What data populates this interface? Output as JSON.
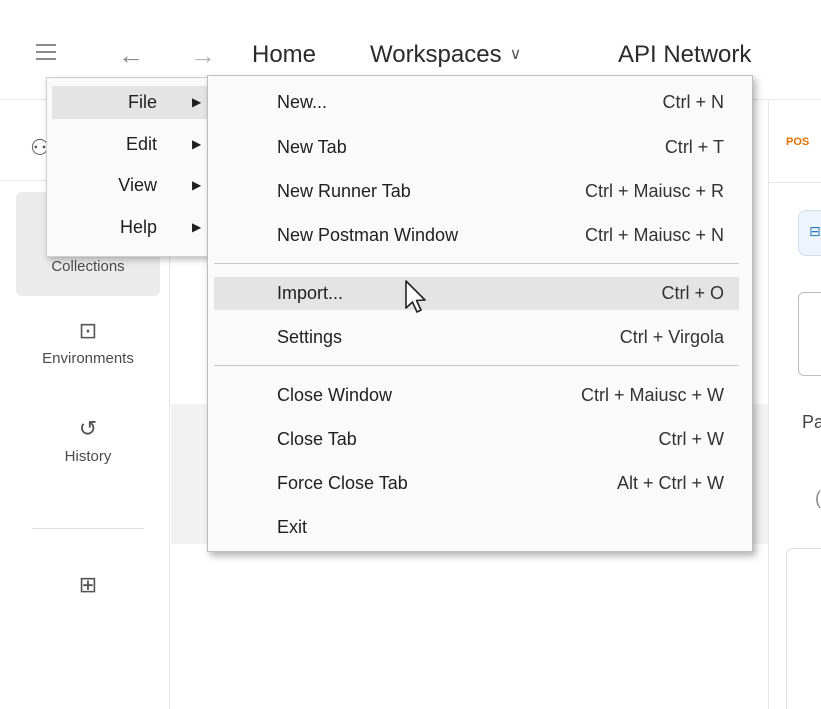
{
  "topbar": {
    "home": "Home",
    "workspaces": "Workspaces",
    "api_network": "API Network"
  },
  "sidebar": {
    "items": [
      {
        "label": "Collections",
        "icon": "collections-icon"
      },
      {
        "label": "Environments",
        "icon": "environments-icon"
      },
      {
        "label": "History",
        "icon": "history-icon"
      }
    ]
  },
  "right_panel": {
    "tab": "POS",
    "text": "Pa",
    "paren": "("
  },
  "app_menu": {
    "items": [
      {
        "label": "File"
      },
      {
        "label": "Edit"
      },
      {
        "label": "View"
      },
      {
        "label": "Help"
      }
    ]
  },
  "file_menu": {
    "items": [
      {
        "label": "New...",
        "shortcut": "Ctrl + N"
      },
      {
        "label": "New Tab",
        "shortcut": "Ctrl + T"
      },
      {
        "label": "New Runner Tab",
        "shortcut": "Ctrl + Maiusc + R"
      },
      {
        "label": "New Postman Window",
        "shortcut": "Ctrl + Maiusc + N"
      },
      {
        "label": "Import...",
        "shortcut": "Ctrl + O"
      },
      {
        "label": "Settings",
        "shortcut": "Ctrl + Virgola"
      },
      {
        "label": "Close Window",
        "shortcut": "Ctrl + Maiusc + W"
      },
      {
        "label": "Close Tab",
        "shortcut": "Ctrl + W"
      },
      {
        "label": "Force Close Tab",
        "shortcut": "Alt + Ctrl + W"
      },
      {
        "label": "Exit",
        "shortcut": ""
      }
    ]
  }
}
